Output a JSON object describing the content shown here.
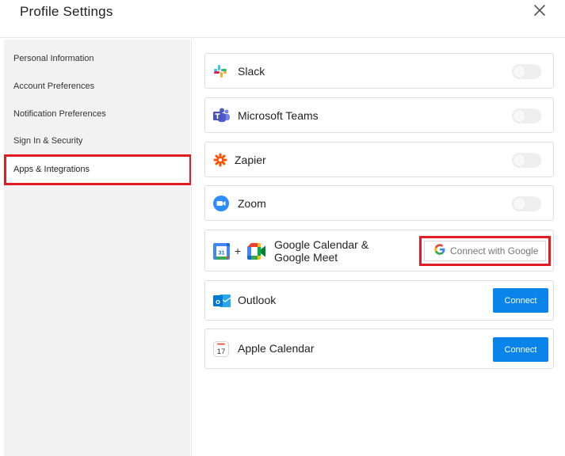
{
  "header": {
    "title": "Profile Settings"
  },
  "sidebar": {
    "items": [
      {
        "label": "Personal Information"
      },
      {
        "label": "Account Preferences"
      },
      {
        "label": "Notification Preferences"
      },
      {
        "label": "Sign In & Security"
      },
      {
        "label": "Apps & Integrations"
      }
    ],
    "active_index": 4
  },
  "integrations": [
    {
      "name": "Slack",
      "control": "toggle",
      "enabled": false
    },
    {
      "name": "Microsoft Teams",
      "control": "toggle",
      "enabled": false
    },
    {
      "name": "Zapier",
      "control": "toggle",
      "enabled": false
    },
    {
      "name": "Zoom",
      "control": "toggle",
      "enabled": false
    },
    {
      "name": "Google Calendar &",
      "name_line2": "Google Meet",
      "plus": "+",
      "control": "google-button",
      "button_label": "Connect with Google"
    },
    {
      "name": "Outlook",
      "control": "button",
      "button_label": "Connect",
      "outlook_letter": "o"
    },
    {
      "name": "Apple Calendar",
      "control": "button",
      "button_label": "Connect",
      "calendar_day": "17"
    }
  ],
  "colors": {
    "accent": "#0a84e8",
    "highlight": "#e31c24",
    "sidebar_bg": "#f2f2f2"
  }
}
